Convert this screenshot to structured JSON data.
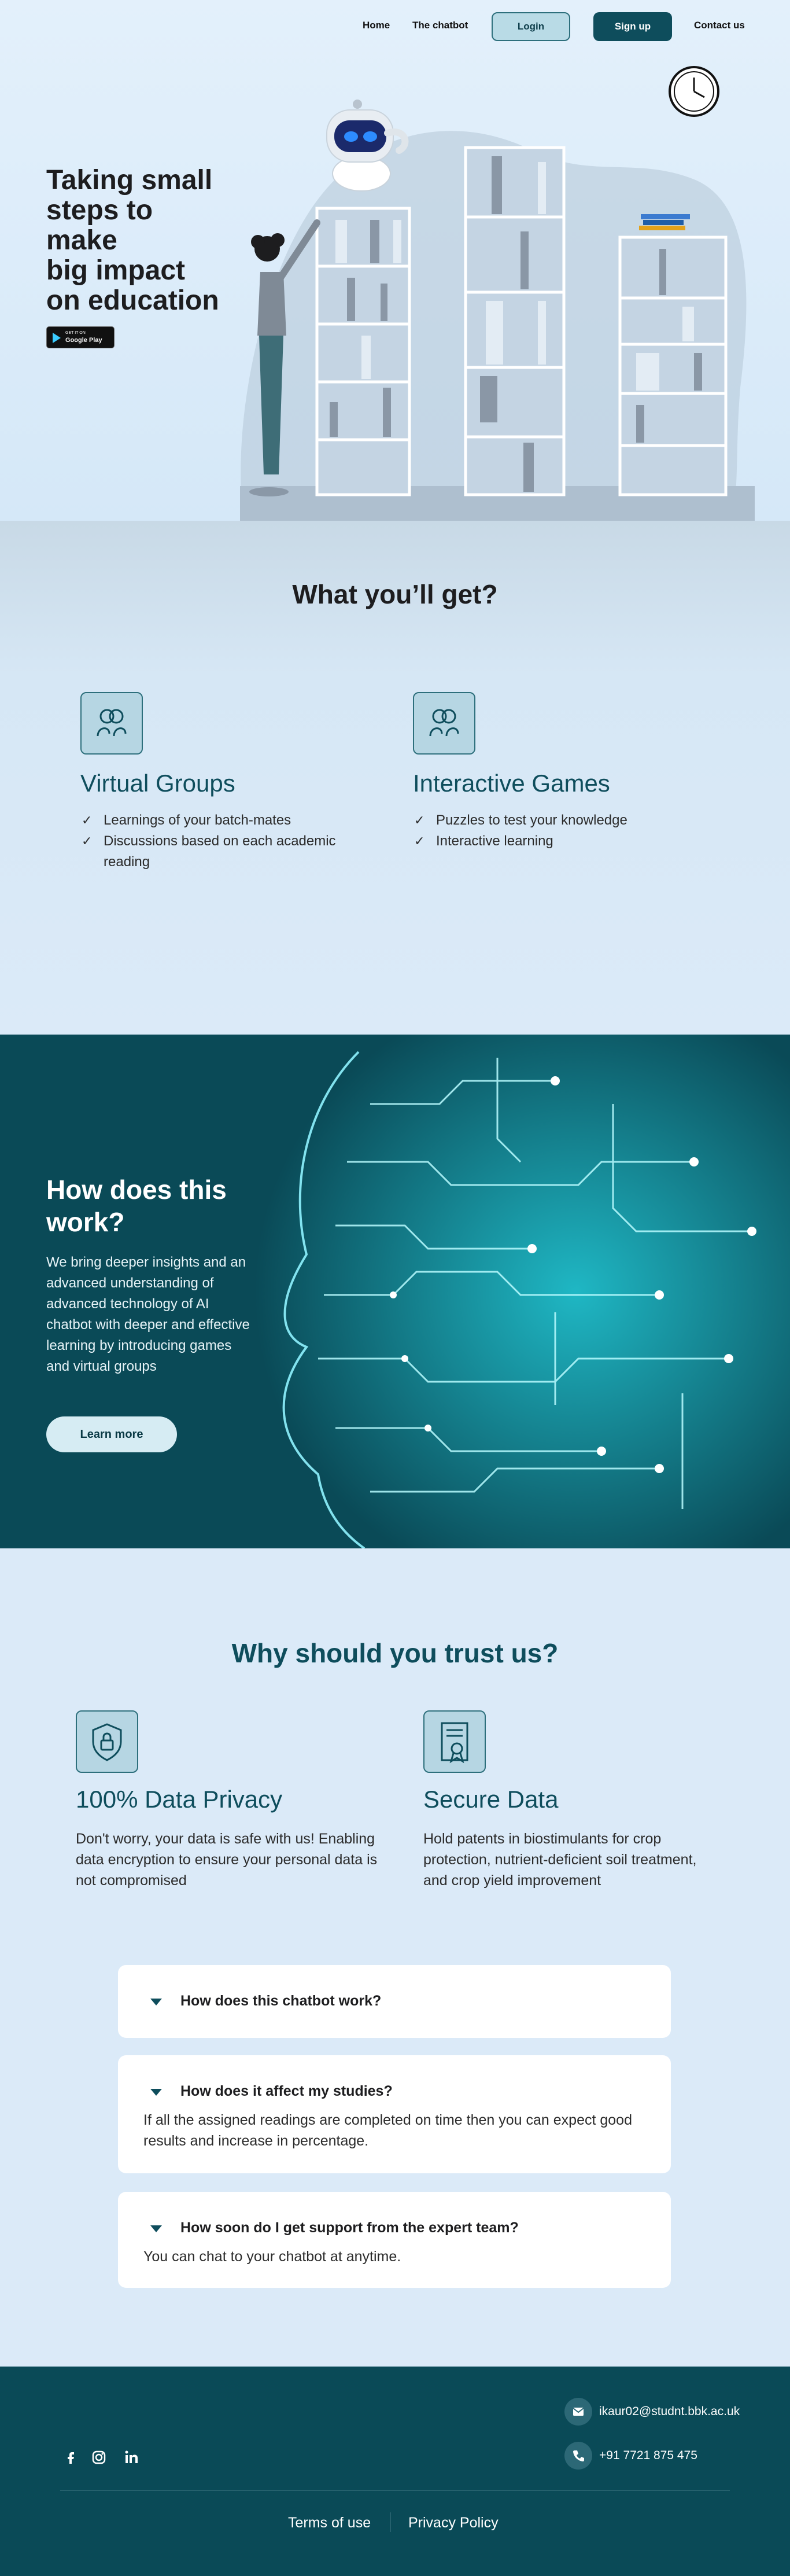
{
  "nav": {
    "home": "Home",
    "chatbot": "The chatbot",
    "login": "Login",
    "signup": "Sign up",
    "contact": "Contact us"
  },
  "hero": {
    "title": "Taking small\nsteps to\nmake\nbig impact\non education",
    "store_badge_small": "GET IT ON",
    "store_badge_big": "Google Play"
  },
  "get": {
    "title": "What you’ll get?",
    "features": [
      {
        "icon": "group-icon",
        "title": "Virtual Groups",
        "items": [
          "Learnings of your batch-mates",
          "Discussions based on each academic reading"
        ]
      },
      {
        "icon": "group-icon",
        "title": "Interactive Games",
        "items": [
          "Puzzles to test your knowledge",
          "Interactive learning"
        ]
      }
    ]
  },
  "how": {
    "title": "How does this work?",
    "text": "We bring deeper insights and an advanced understanding of advanced technology of AI chatbot with deeper and effective learning by introducing games and virtual groups",
    "button": "Learn more"
  },
  "trust": {
    "title": "Why should you trust us?",
    "cards": [
      {
        "icon": "shield-lock-icon",
        "title": "100% Data Privacy",
        "text": "Don't worry, your data is safe with us! Enabling data encryption to ensure your personal data is not compromised"
      },
      {
        "icon": "certificate-icon",
        "title": "Secure Data",
        "text": "Hold patents in biostimulants for crop protection, nutrient-deficient soil treatment, and crop yield improvement"
      }
    ]
  },
  "faq": [
    {
      "question": "How does this chatbot work?",
      "answer": ""
    },
    {
      "question": "How does it affect my studies?",
      "answer": "If all the assigned readings are completed on time then you can expect good results and increase in percentage."
    },
    {
      "question": "How soon do I get support from the expert team?",
      "answer": "You can chat to your chatbot at anytime."
    }
  ],
  "footer": {
    "email": "ikaur02@studnt.bbk.ac.uk",
    "phone": "+91 7721 875 475",
    "terms": "Terms of use",
    "privacy": "Privacy Policy"
  },
  "colors": {
    "primary": "#0e4d5c",
    "background": "#dbeaf8",
    "accent": "#b9dbe6"
  }
}
